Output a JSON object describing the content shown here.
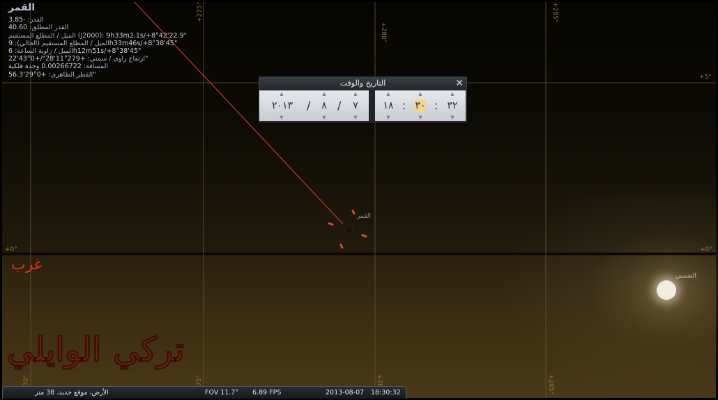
{
  "object_info": {
    "name": "القمر",
    "rows": [
      {
        "label": "القدر:",
        "value": "-3.85"
      },
      {
        "label": "القدر المطلق:",
        "value": "40.60"
      },
      {
        "label": "الميل / المطلع المستقيم (J2000):",
        "value": "9h33m2.1s/+8°42'22.9\""
      },
      {
        "label": "الميل / المطلع المستقيم (الحالي):",
        "value": "9h33m46s/+8°38'45\""
      },
      {
        "label": "الميل / زاوية الساعة:",
        "value": "6h12m51s/+8°38'45\""
      },
      {
        "label": "ارتفاع زاوي / سمتي:",
        "value": "+279°11'28\"/+0°43'22\""
      },
      {
        "label": "المسافة:",
        "value": "0.00266722 وحدة فلكية"
      },
      {
        "label": "القطر الظاهري:",
        "value": "+0°29'56.3\""
      }
    ]
  },
  "dialog": {
    "title": "التاريخ والوقت",
    "close_glyph": "✕",
    "date": {
      "year": "٢٠١٣",
      "month": "٨",
      "day": "٧",
      "separator": "/"
    },
    "time": {
      "hour": "١٨",
      "minute": "٣٠",
      "second": "٣٢",
      "separator": ":"
    },
    "spin_up": "▲",
    "spin_down": "▼"
  },
  "grid_labels": {
    "ra_top": [
      "+275°",
      "+280°",
      "+285°"
    ],
    "ra_bottom": [
      "+270°",
      "+275°",
      "+280°",
      "+285°"
    ],
    "dec_5": "+5°",
    "dec_0": "+0°"
  },
  "sky_labels": {
    "moon": "القمر",
    "sun": "الشمس",
    "direction": "غرب",
    "watermark": "تركي الوايلي"
  },
  "status_bar": {
    "location": "الأرض، موقع جديد، 38 متر",
    "fov": "FOV 11.7°",
    "fps": "6.89 FPS",
    "date": "2013-08-07",
    "time": "18:30:32"
  },
  "colors": {
    "grid": "#6b5a30",
    "moon_marker": "#d8502a",
    "pointer_line": "#c0392b",
    "direction": "#e0301a"
  }
}
